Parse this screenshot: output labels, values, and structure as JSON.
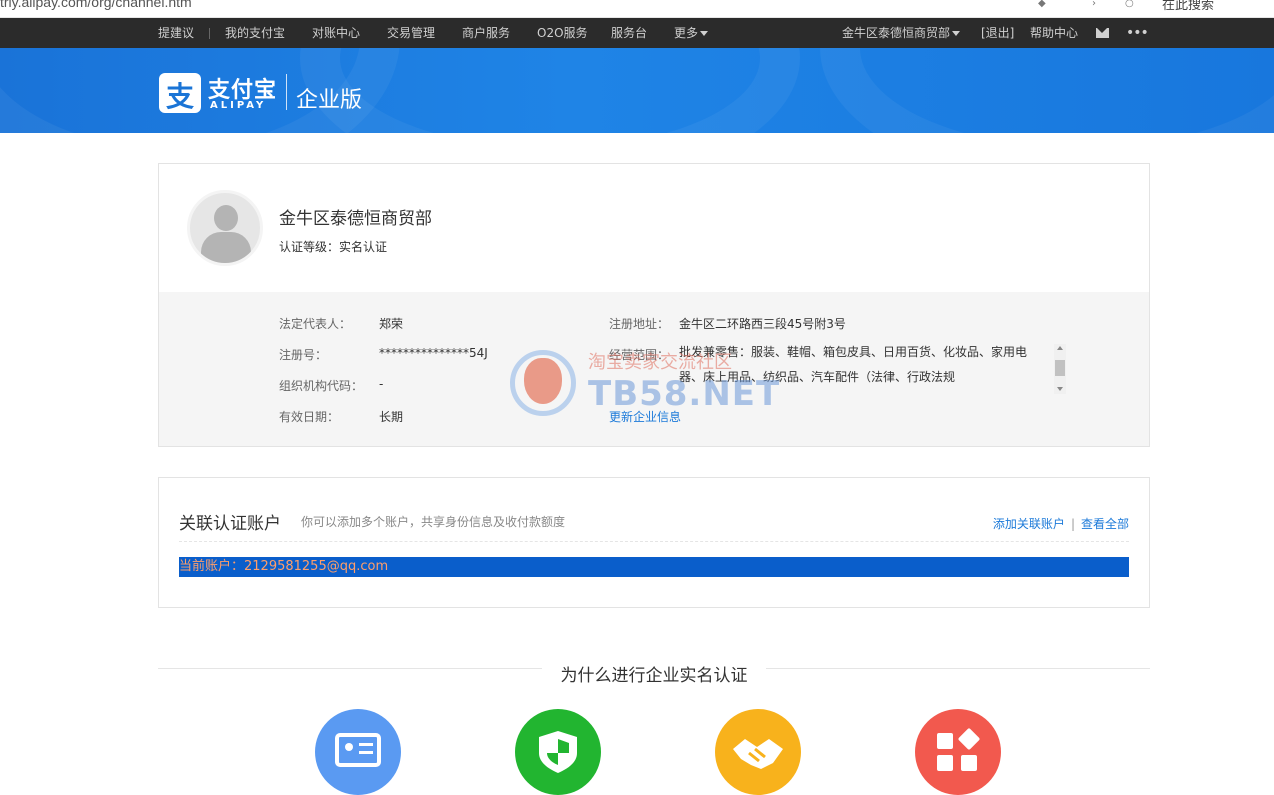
{
  "browser": {
    "url": "trly.alipay.com/org/channel.htm",
    "search_label": "在此搜索"
  },
  "topnav": {
    "left_items": [
      "提建议",
      "我的支付宝",
      "对账中心",
      "交易管理",
      "商户服务",
      "O2O服务",
      "服务台",
      "更多"
    ],
    "account_name": "金牛区泰德恒商贸部",
    "logout": "[退出]",
    "help": "帮助中心"
  },
  "banner": {
    "logo_cn": "支付宝",
    "logo_en": "ALIPAY",
    "logo_glyph": "支",
    "edition": "企业版"
  },
  "profile": {
    "company_name": "金牛区泰德恒商贸部",
    "cert_level": "认证等级：实名认证",
    "fields": {
      "legal_rep_label": "法定代表人：",
      "legal_rep_value": "郑荣",
      "reg_no_label": "注册号：",
      "reg_no_value": "***************54J",
      "org_code_label": "组织机构代码：",
      "org_code_value": "-",
      "valid_label": "有效日期：",
      "valid_value": "长期",
      "address_label": "注册地址：",
      "address_value": "金牛区二环路西三段45号附3号",
      "scope_label": "经营范围：",
      "scope_value": "批发兼零售：服装、鞋帽、箱包皮具、日用百货、化妆品、家用电器、床上用品、纺织品、汽车配件（法律、行政法规"
    },
    "update_link": "更新企业信息"
  },
  "watermark": {
    "line1": "淘宝卖家交流社区",
    "line2": "TB58.NET"
  },
  "linked_accounts": {
    "title": "关联认证账户",
    "subtitle": "你可以添加多个账户，共享身份信息及收付款额度",
    "add_link": "添加关联账户",
    "divider": "|",
    "view_all": "查看全部",
    "current_account": "当前账户：2129581255@qq.com"
  },
  "why": {
    "title": "为什么进行企业实名认证",
    "features": [
      {
        "icon": "id-card-icon",
        "color": "#5a9af2"
      },
      {
        "icon": "shield-icon",
        "color": "#22b530"
      },
      {
        "icon": "handshake-icon",
        "color": "#f8b21c"
      },
      {
        "icon": "apps-icon",
        "color": "#f2594e"
      }
    ]
  }
}
